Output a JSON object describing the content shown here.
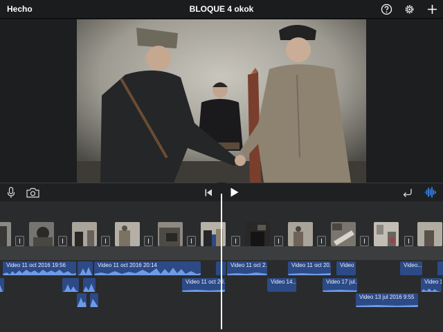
{
  "header": {
    "done_label": "Hecho",
    "project_title": "BLOQUE 4 okok",
    "help_icon": "question-circle-icon",
    "settings_icon": "gear-icon",
    "add_icon": "plus-icon"
  },
  "toolbar": {
    "mic_icon": "microphone-icon",
    "camera_icon": "camera-icon",
    "skip_back_icon": "skip-to-start-icon",
    "play_icon": "play-icon",
    "undo_icon": "undo-icon",
    "audio_icon": "audio-waveform-icon"
  },
  "timeline": {
    "audio_clips": [
      {
        "label": "Video 11 oct 2016 19:56"
      },
      {
        "label": ""
      },
      {
        "label": "Video 11 oct 2016 20:14"
      },
      {
        "label": ""
      },
      {
        "label": "Video 11 oct 2..."
      },
      {
        "label": "Video 11 oct 20..."
      },
      {
        "label": "Video ..."
      },
      {
        "label": "Video..."
      },
      {
        "label": ""
      },
      {
        "label": ""
      },
      {
        "label": ""
      },
      {
        "label": "Video 11 oct 20..."
      },
      {
        "label": "Video 14..."
      },
      {
        "label": "Video 17 jul..."
      },
      {
        "label": "Video 1..."
      },
      {
        "label": ""
      },
      {
        "label": ""
      },
      {
        "label": "Video 13 jul 2016 9:55"
      }
    ]
  },
  "colors": {
    "accent": "#3b8cff",
    "audio_clip": "#2c4a86",
    "waveform": "#6f9be6"
  }
}
